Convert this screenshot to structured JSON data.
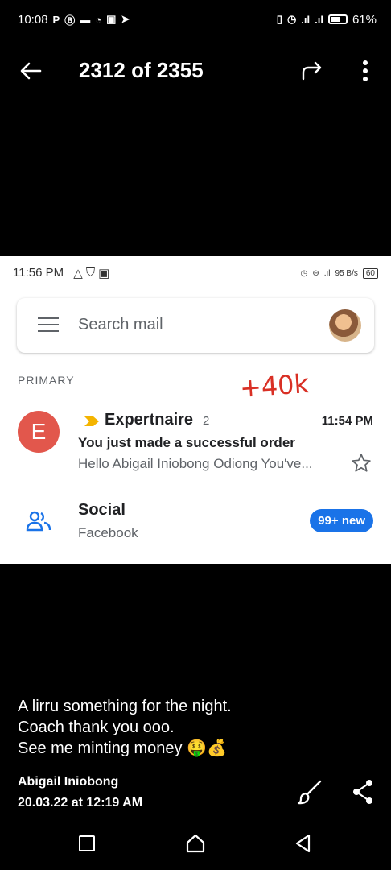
{
  "status": {
    "time": "10:08",
    "left_icons": [
      "P",
      "B",
      "=",
      "whatsapp-icon",
      "gallery-icon",
      "telegram-icon"
    ],
    "battery": "61%"
  },
  "viewer": {
    "counter": "2312 of 2355"
  },
  "embedded": {
    "status_time": "11:56 PM",
    "net_speed": "95 B/s",
    "battery": "60",
    "search_placeholder": "Search mail",
    "primary_label": "PRIMARY",
    "handwritten_note": "+40k",
    "email": {
      "avatar_letter": "E",
      "sender": "Expertnaire",
      "count": "2",
      "time": "11:54 PM",
      "subject": "You just made a successful order",
      "snippet": "Hello Abigail Iniobong Odiong You've..."
    },
    "social": {
      "title": "Social",
      "subtitle": "Facebook",
      "badge": "99+ new"
    }
  },
  "caption": {
    "line1": "A lirru something for the night.",
    "line2": "Coach thank you ooo.",
    "line3": "See me minting money 🤑💰"
  },
  "meta": {
    "author": "Abigail Iniobong",
    "date": "20.03.22 at 12:19 AM"
  },
  "colors": {
    "accent_blue": "#1a73e8",
    "avatar_red": "#e2574c",
    "note_red": "#d93025"
  }
}
